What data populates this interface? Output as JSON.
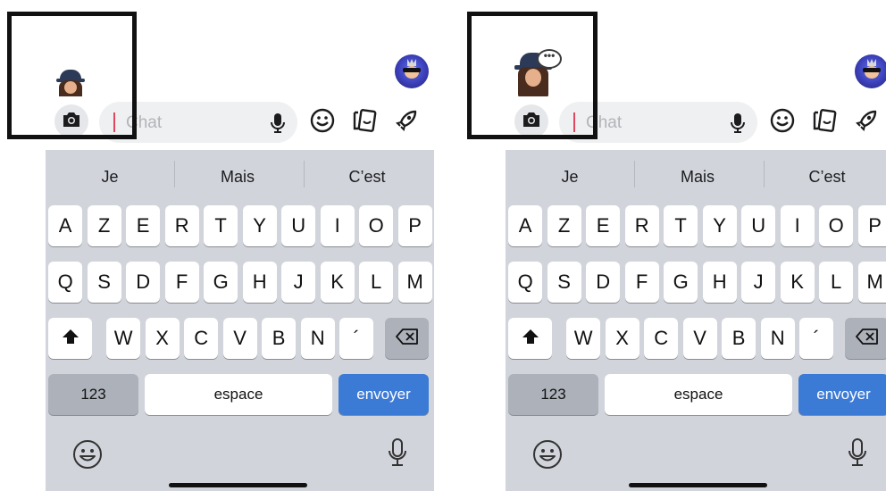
{
  "chat": {
    "placeholder": "Chat"
  },
  "suggestions": [
    "Je",
    "Mais",
    "C’est"
  ],
  "keyboard": {
    "row1": [
      "A",
      "Z",
      "E",
      "R",
      "T",
      "Y",
      "U",
      "I",
      "O",
      "P"
    ],
    "row2": [
      "Q",
      "S",
      "D",
      "F",
      "G",
      "H",
      "J",
      "K",
      "L",
      "M"
    ],
    "row3": [
      "W",
      "X",
      "C",
      "V",
      "B",
      "N",
      "´"
    ],
    "numbers_label": "123",
    "space_label": "espace",
    "send_label": "envoyer"
  },
  "thought_bubble": "•••",
  "colors": {
    "send_key": "#3b7bd6",
    "caret": "#e0475e",
    "keyboard_bg": "#d1d4db"
  },
  "icons": [
    "camera-icon",
    "microphone-icon",
    "smiley-icon",
    "sticker-icon",
    "rocket-icon",
    "shift-icon",
    "backspace-icon",
    "emoji-icon",
    "dictation-icon"
  ]
}
